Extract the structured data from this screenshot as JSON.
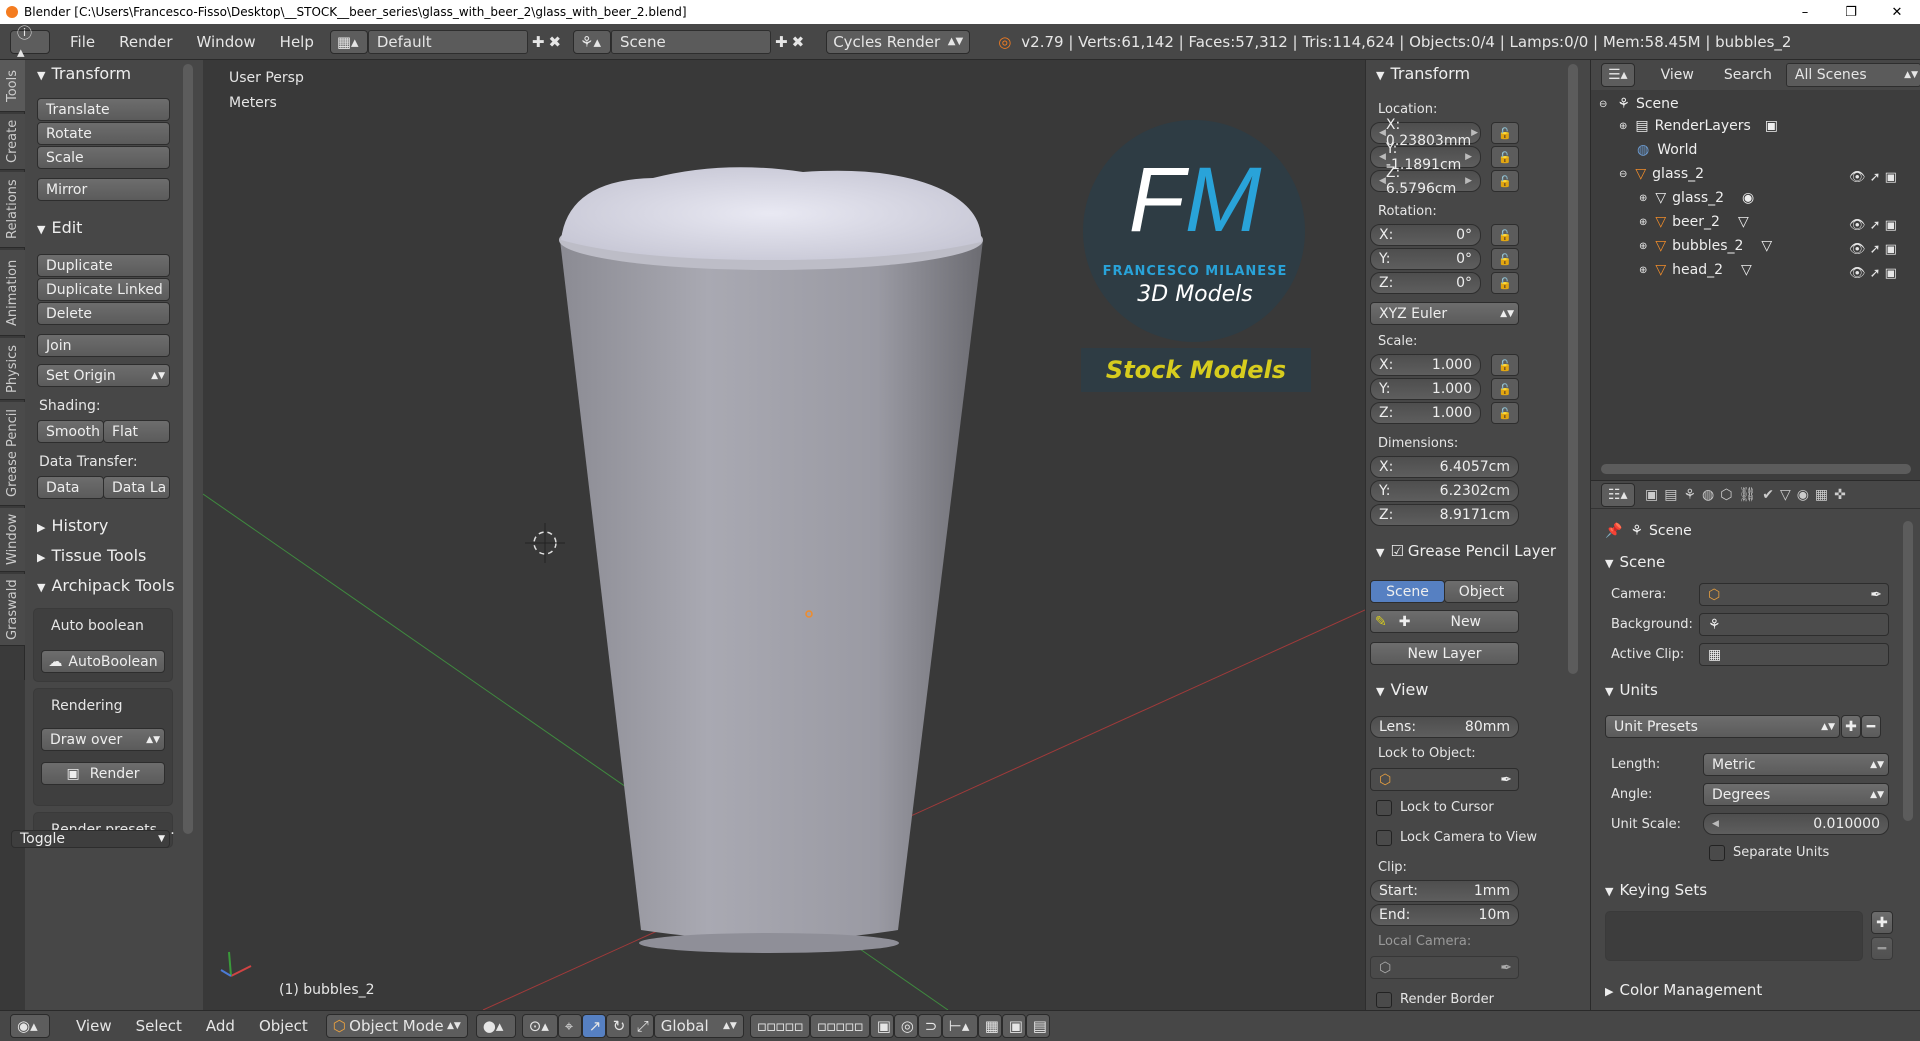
{
  "window": {
    "title": "Blender [C:\\Users\\Francesco-Fisso\\Desktop\\__STOCK__beer_series\\glass_with_beer_2\\glass_with_beer_2.blend]",
    "min": "–",
    "max": "❐",
    "close": "✕"
  },
  "infobar": {
    "menus": [
      "File",
      "Render",
      "Window",
      "Help"
    ],
    "layout": "Default",
    "scene": "Scene",
    "engine": "Cycles Render",
    "stats": "v2.79 | Verts:61,142 | Faces:57,312 | Tris:114,624 | Objects:0/4 | Lamps:0/0 | Mem:58.45M | bubbles_2"
  },
  "tabs": [
    "Tools",
    "Create",
    "Relations",
    "Animation",
    "Physics",
    "Grease Pencil",
    "Window",
    "Graswald"
  ],
  "toolshelf": {
    "transform": {
      "title": "Transform",
      "buttons": [
        "Translate",
        "Rotate",
        "Scale",
        "Mirror"
      ]
    },
    "edit": {
      "title": "Edit",
      "buttons": [
        "Duplicate",
        "Duplicate Linked",
        "Delete",
        "Join"
      ],
      "set_origin": "Set Origin"
    },
    "shading": {
      "label": "Shading:",
      "smooth": "Smooth",
      "flat": "Flat"
    },
    "data_transfer": {
      "label": "Data Transfer:",
      "data": "Data",
      "data_la": "Data La"
    },
    "history": "History",
    "tissue": "Tissue Tools",
    "archipack": "Archipack Tools",
    "auto_boolean": "Auto boolean",
    "autoboolean_btn": "AutoBoolean",
    "rendering": "Rendering",
    "draw_over": "Draw over",
    "render": "Render",
    "render_presets": "Render presets ...",
    "toggle": "Toggle"
  },
  "viewport": {
    "view_name": "User Persp",
    "units": "Meters",
    "object_label": "(1) bubbles_2",
    "logo": {
      "letters": "FM",
      "name": "FRANCESCO MILANESE",
      "sub": "3D Models",
      "stock": "Stock Models"
    }
  },
  "npanel": {
    "transform": "Transform",
    "location_label": "Location:",
    "location": [
      "X: 0.23803mm",
      "Y: -1.1891cm",
      "Z: 6.5796cm"
    ],
    "rotation_label": "Rotation:",
    "rotation": [
      [
        "X:",
        "0°"
      ],
      [
        "Y:",
        "0°"
      ],
      [
        "Z:",
        "0°"
      ]
    ],
    "rotation_mode": "XYZ Euler",
    "scale_label": "Scale:",
    "scale": [
      [
        "X:",
        "1.000"
      ],
      [
        "Y:",
        "1.000"
      ],
      [
        "Z:",
        "1.000"
      ]
    ],
    "dimensions_label": "Dimensions:",
    "dimensions": [
      [
        "X:",
        "6.4057cm"
      ],
      [
        "Y:",
        "6.2302cm"
      ],
      [
        "Z:",
        "8.9171cm"
      ]
    ],
    "grease_pencil": "Grease Pencil Layer",
    "gp_scene": "Scene",
    "gp_object": "Object",
    "gp_new": "New",
    "gp_new_layer": "New Layer",
    "view": "View",
    "lens_label": "Lens:",
    "lens": "80mm",
    "lock_to_object": "Lock to Object:",
    "lock_to_cursor": "Lock to Cursor",
    "lock_camera": "Lock Camera to View",
    "clip_label": "Clip:",
    "clip_start": [
      "Start:",
      "1mm"
    ],
    "clip_end": [
      "End:",
      "10m"
    ],
    "local_camera": "Local Camera:",
    "render_border": "Render Border"
  },
  "outliner": {
    "view": "View",
    "search": "Search",
    "filter": "All Scenes",
    "items": [
      "Scene",
      "RenderLayers",
      "World",
      "glass_2",
      "glass_2",
      "beer_2",
      "bubbles_2",
      "head_2"
    ]
  },
  "properties": {
    "breadcrumb": "Scene",
    "scene_panel": "Scene",
    "camera": "Camera:",
    "background": "Background:",
    "active_clip": "Active Clip:",
    "units_panel": "Units",
    "unit_presets": "Unit Presets",
    "length_label": "Length:",
    "length": "Metric",
    "angle_label": "Angle:",
    "angle": "Degrees",
    "unit_scale_label": "Unit Scale:",
    "unit_scale": "0.010000",
    "separate_units": "Separate Units",
    "keying_sets": "Keying Sets",
    "color_management": "Color Management"
  },
  "footer": {
    "view": "View",
    "select": "Select",
    "add": "Add",
    "object": "Object",
    "mode": "Object Mode",
    "orientation": "Global"
  },
  "colors": {
    "accent": "#5680c2",
    "logo_blue": "#29a3d9",
    "stock_yellow": "#d7cc1e",
    "axis_red": "#a03a3a",
    "axis_green": "#3f8a3f"
  }
}
